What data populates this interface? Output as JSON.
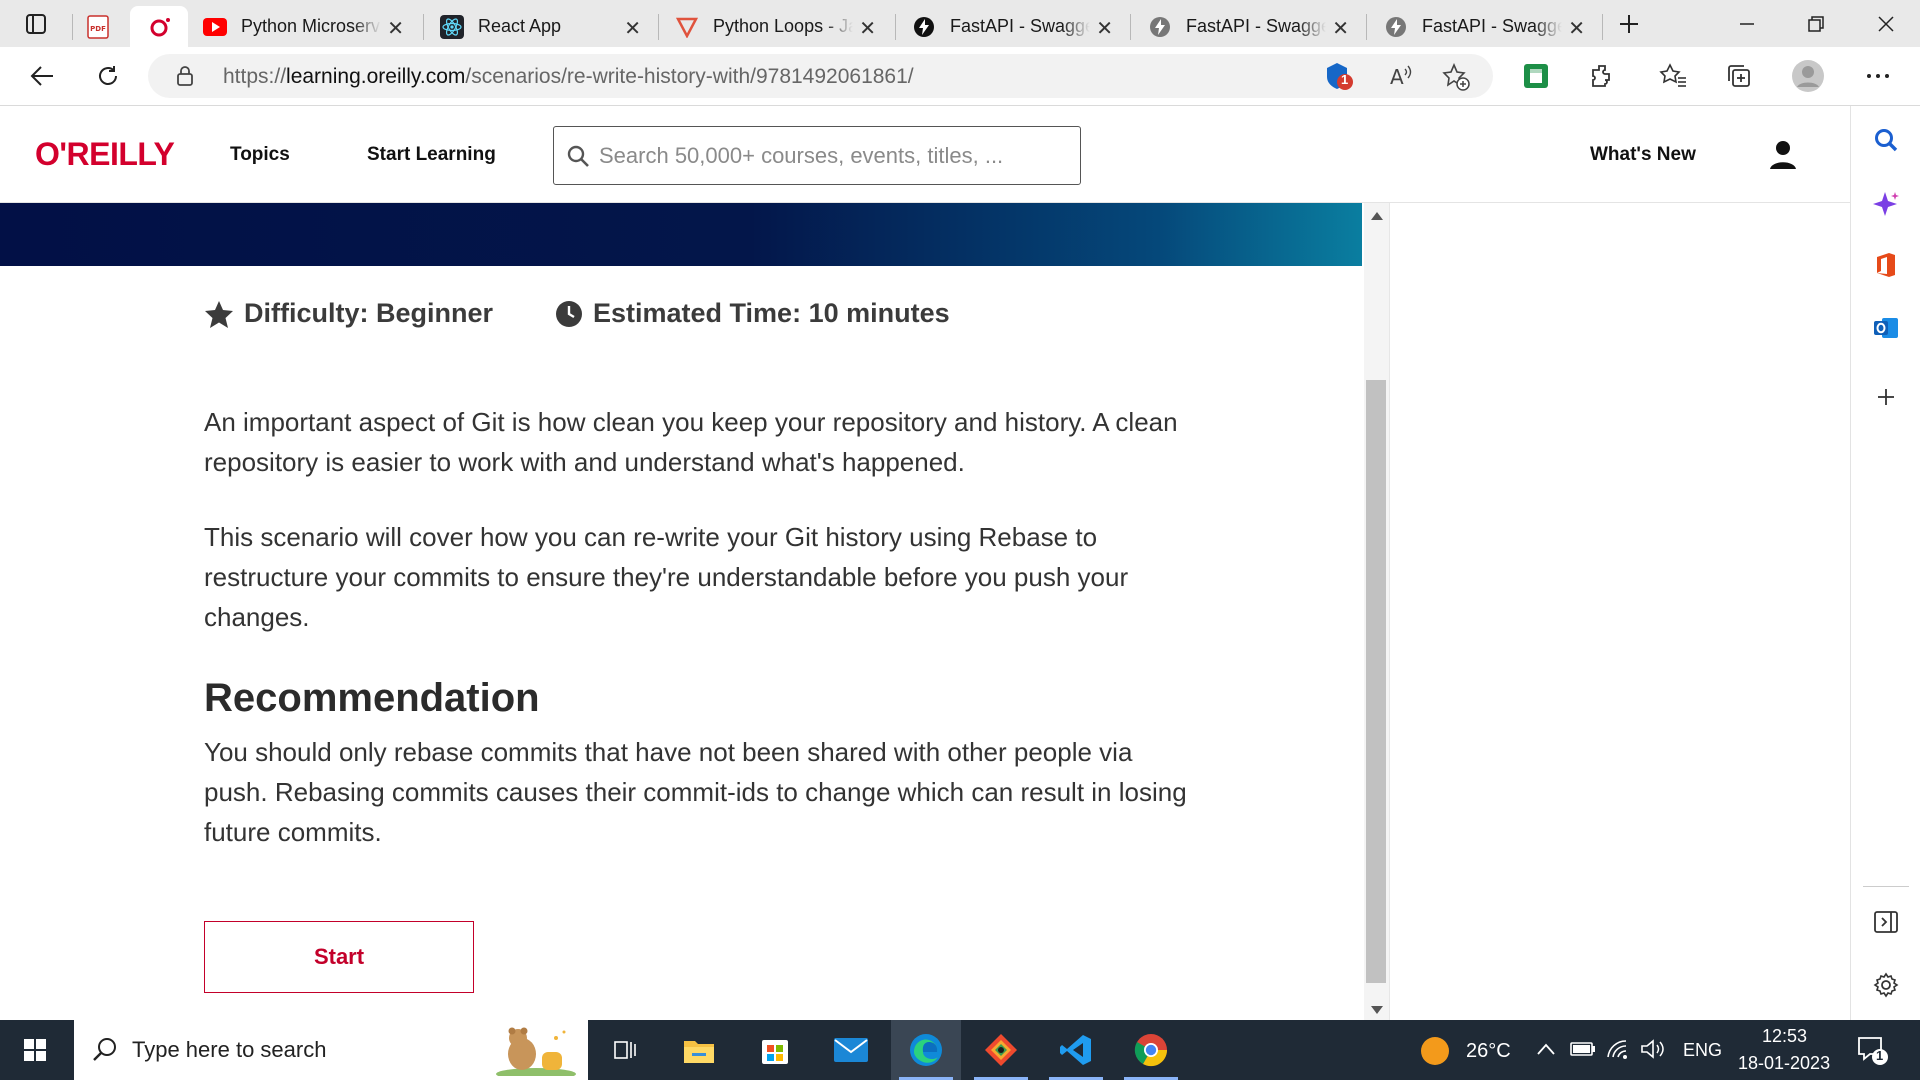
{
  "browser": {
    "tabs": [
      {
        "title": "",
        "icon": "pdf-icon",
        "active": false
      },
      {
        "title": "",
        "icon": "oreilly-icon",
        "active": true
      },
      {
        "title": "Python Microservices",
        "icon": "youtube-icon",
        "active": false
      },
      {
        "title": "React App",
        "icon": "react-icon",
        "active": false
      },
      {
        "title": "Python Loops - Javatpoint",
        "icon": "javatpoint-icon",
        "active": false
      },
      {
        "title": "FastAPI - Swagger UI",
        "icon": "fastapi-icon",
        "active": false
      },
      {
        "title": "FastAPI - Swagger UI",
        "icon": "fastapi-icon",
        "active": false
      },
      {
        "title": "FastAPI - Swagger UI",
        "icon": "fastapi-icon",
        "active": false
      }
    ],
    "url_prefix": "https://",
    "url_host": "learning.oreilly.com",
    "url_path": "/scenarios/re-write-history-with/9781492061861/",
    "notification_count": "1"
  },
  "header": {
    "logo": "O'REILLY",
    "nav_topics": "Topics",
    "nav_start_learning": "Start Learning",
    "search_placeholder": "Search 50,000+ courses, events, titles, ...",
    "whats_new": "What's New"
  },
  "content": {
    "difficulty": "Difficulty: Beginner",
    "estimated_time": "Estimated Time: 10 minutes",
    "para1": "An important aspect of Git is how clean you keep your repository and history. A clean repository is easier to work with and understand what's happened.",
    "para2": "This scenario will cover how you can re-write your Git history using Rebase to restructure your commits to ensure they're understandable before you push your changes.",
    "recommendation_title": "Recommendation",
    "recommendation_text": "You should only rebase commits that have not been shared with other people via push. Rebasing commits causes their commit-ids to change which can result in losing future commits.",
    "start_label": "Start"
  },
  "taskbar": {
    "search_placeholder": "Type here to search",
    "temperature": "26°C",
    "language": "ENG",
    "time": "12:53",
    "date": "18-01-2023",
    "notification_count": "1"
  },
  "colors": {
    "brand": "#d3002d",
    "banner_start": "#021046",
    "banner_end": "#0a7ea0"
  }
}
